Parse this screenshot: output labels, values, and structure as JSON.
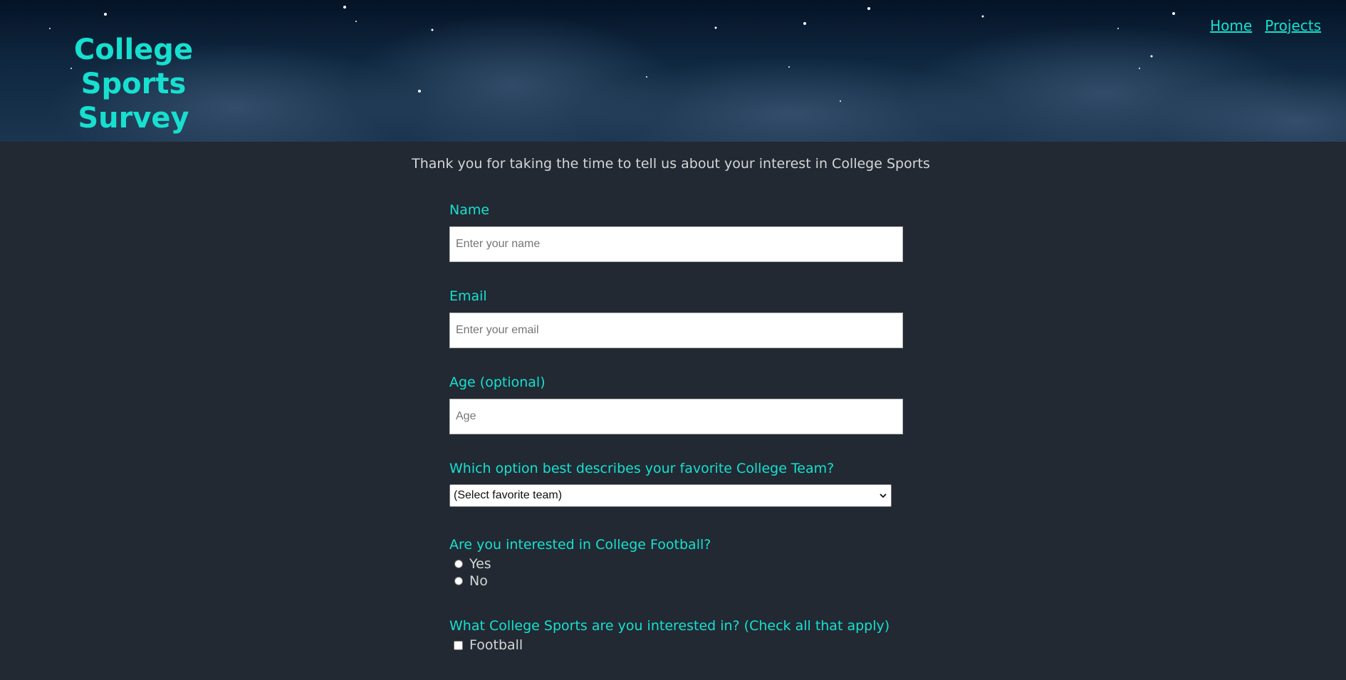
{
  "header": {
    "title": "College Sports Survey",
    "nav": [
      {
        "label": "Home"
      },
      {
        "label": "Projects"
      }
    ]
  },
  "intro": "Thank you for taking the time to tell us about your interest in College Sports",
  "form": {
    "name": {
      "label": "Name",
      "placeholder": "Enter your name",
      "value": ""
    },
    "email": {
      "label": "Email",
      "placeholder": "Enter your email",
      "value": ""
    },
    "age": {
      "label": "Age (optional)",
      "placeholder": "Age",
      "value": ""
    },
    "team": {
      "label": "Which option best describes your favorite College Team?",
      "selected": "(Select favorite team)"
    },
    "football": {
      "label": "Are you interested in College Football?",
      "options": [
        "Yes",
        "No"
      ]
    },
    "sports": {
      "label": "What College Sports are you interested in? (Check all that apply)",
      "options": [
        "Football"
      ]
    }
  },
  "colors": {
    "accent": "#16e0cf",
    "background": "#222933"
  }
}
